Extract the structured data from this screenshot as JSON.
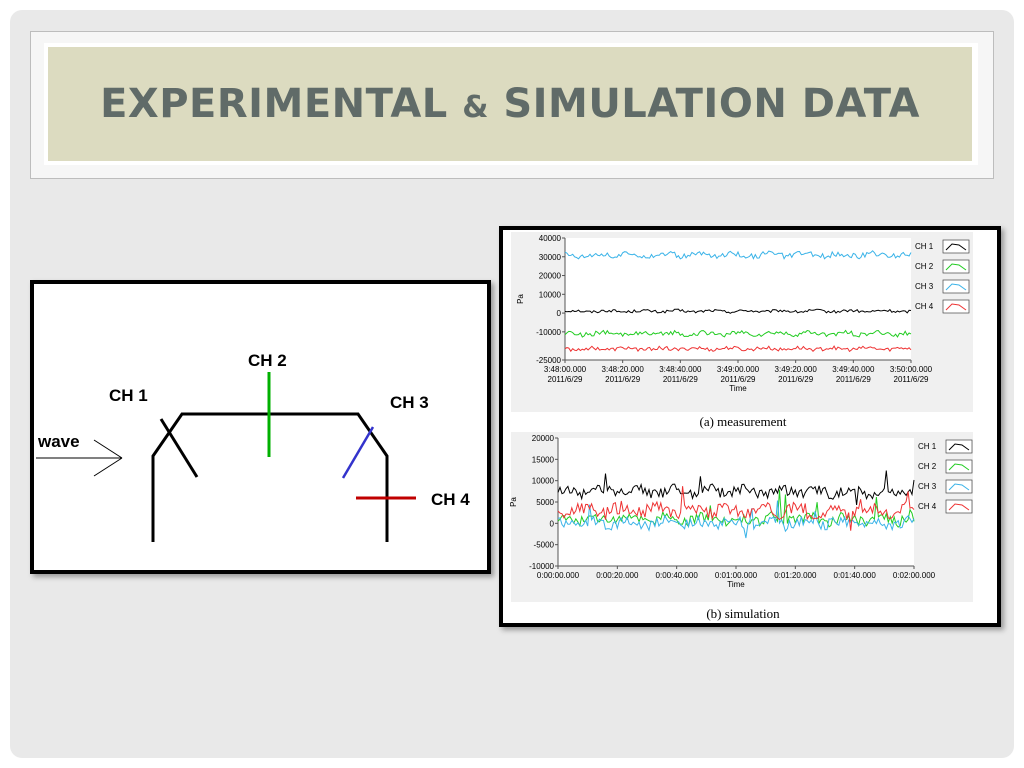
{
  "slide": {
    "title_part1": "EXPERIMENTAL",
    "title_amp": "&",
    "title_part2": "SIMULATION DATA"
  },
  "diagram": {
    "labels": {
      "ch1": "CH 1",
      "ch2": "CH 2",
      "ch3": "CH 3",
      "ch4": "CH 4",
      "wave": "wave"
    },
    "colors": {
      "structure": "#000000",
      "ch2": "#00b000",
      "ch3": "#3333cc",
      "ch4": "#c00000"
    }
  },
  "chart_data": [
    {
      "type": "line",
      "caption": "(a) measurement",
      "xlabel": "Time",
      "ylabel": "Pa",
      "ylim": [
        -25000,
        40000
      ],
      "yticks": [
        "40000",
        "30000",
        "20000",
        "10000",
        "0",
        "-10000",
        "-25000"
      ],
      "xticks": [
        {
          "time": "3:48:00.000",
          "date": "2011/6/29"
        },
        {
          "time": "3:48:20.000",
          "date": "2011/6/29"
        },
        {
          "time": "3:48:40.000",
          "date": "2011/6/29"
        },
        {
          "time": "3:49:00.000",
          "date": "2011/6/29"
        },
        {
          "time": "3:49:20.000",
          "date": "2011/6/29"
        },
        {
          "time": "3:49:40.000",
          "date": "2011/6/29"
        },
        {
          "time": "3:50:00.000",
          "date": "2011/6/29"
        }
      ],
      "legend_position": "right",
      "series": [
        {
          "name": "CH 1",
          "color": "#000000",
          "mean": 1000,
          "amplitude": 1500
        },
        {
          "name": "CH 2",
          "color": "#22cc22",
          "mean": -11000,
          "amplitude": 2500
        },
        {
          "name": "CH 3",
          "color": "#3ab3e8",
          "mean": 31000,
          "amplitude": 3000
        },
        {
          "name": "CH 4",
          "color": "#ee3333",
          "mean": -19000,
          "amplitude": 2000
        }
      ]
    },
    {
      "type": "line",
      "caption": "(b) simulation",
      "xlabel": "Time",
      "ylabel": "Pa",
      "ylim": [
        -10000,
        20000
      ],
      "yticks": [
        "20000",
        "15000",
        "10000",
        "5000",
        "0",
        "-5000",
        "-10000"
      ],
      "xticks": [
        "0:00:00.000",
        "0:00:20.000",
        "0:00:40.000",
        "0:01:00.000",
        "0:01:20.000",
        "0:01:40.000",
        "0:02:00.000"
      ],
      "legend_position": "right",
      "series": [
        {
          "name": "CH 1",
          "color": "#000000",
          "mean": 7500,
          "amplitude": 2500
        },
        {
          "name": "CH 2",
          "color": "#22cc22",
          "mean": 1000,
          "amplitude": 2500
        },
        {
          "name": "CH 3",
          "color": "#3ab3e8",
          "mean": 0,
          "amplitude": 2500
        },
        {
          "name": "CH 4",
          "color": "#ee3333",
          "mean": 3000,
          "amplitude": 3000
        }
      ]
    }
  ]
}
